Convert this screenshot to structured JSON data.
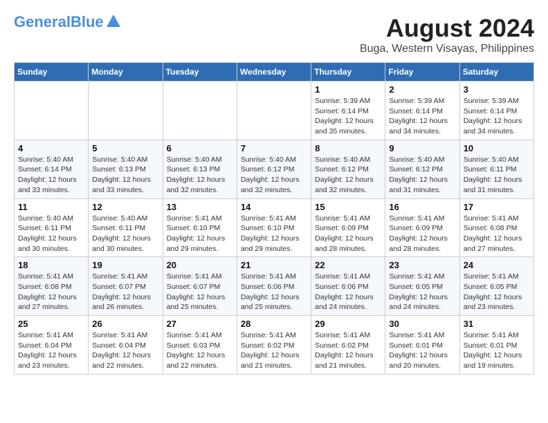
{
  "header": {
    "logo_line1": "General",
    "logo_line2": "Blue",
    "main_title": "August 2024",
    "subtitle": "Buga, Western Visayas, Philippines"
  },
  "calendar": {
    "days_of_week": [
      "Sunday",
      "Monday",
      "Tuesday",
      "Wednesday",
      "Thursday",
      "Friday",
      "Saturday"
    ],
    "weeks": [
      [
        {
          "day": "",
          "info": ""
        },
        {
          "day": "",
          "info": ""
        },
        {
          "day": "",
          "info": ""
        },
        {
          "day": "",
          "info": ""
        },
        {
          "day": "1",
          "info": "Sunrise: 5:39 AM\nSunset: 6:14 PM\nDaylight: 12 hours\nand 35 minutes."
        },
        {
          "day": "2",
          "info": "Sunrise: 5:39 AM\nSunset: 6:14 PM\nDaylight: 12 hours\nand 34 minutes."
        },
        {
          "day": "3",
          "info": "Sunrise: 5:39 AM\nSunset: 6:14 PM\nDaylight: 12 hours\nand 34 minutes."
        }
      ],
      [
        {
          "day": "4",
          "info": "Sunrise: 5:40 AM\nSunset: 6:14 PM\nDaylight: 12 hours\nand 33 minutes."
        },
        {
          "day": "5",
          "info": "Sunrise: 5:40 AM\nSunset: 6:13 PM\nDaylight: 12 hours\nand 33 minutes."
        },
        {
          "day": "6",
          "info": "Sunrise: 5:40 AM\nSunset: 6:13 PM\nDaylight: 12 hours\nand 32 minutes."
        },
        {
          "day": "7",
          "info": "Sunrise: 5:40 AM\nSunset: 6:12 PM\nDaylight: 12 hours\nand 32 minutes."
        },
        {
          "day": "8",
          "info": "Sunrise: 5:40 AM\nSunset: 6:12 PM\nDaylight: 12 hours\nand 32 minutes."
        },
        {
          "day": "9",
          "info": "Sunrise: 5:40 AM\nSunset: 6:12 PM\nDaylight: 12 hours\nand 31 minutes."
        },
        {
          "day": "10",
          "info": "Sunrise: 5:40 AM\nSunset: 6:11 PM\nDaylight: 12 hours\nand 31 minutes."
        }
      ],
      [
        {
          "day": "11",
          "info": "Sunrise: 5:40 AM\nSunset: 6:11 PM\nDaylight: 12 hours\nand 30 minutes."
        },
        {
          "day": "12",
          "info": "Sunrise: 5:40 AM\nSunset: 6:11 PM\nDaylight: 12 hours\nand 30 minutes."
        },
        {
          "day": "13",
          "info": "Sunrise: 5:41 AM\nSunset: 6:10 PM\nDaylight: 12 hours\nand 29 minutes."
        },
        {
          "day": "14",
          "info": "Sunrise: 5:41 AM\nSunset: 6:10 PM\nDaylight: 12 hours\nand 29 minutes."
        },
        {
          "day": "15",
          "info": "Sunrise: 5:41 AM\nSunset: 6:09 PM\nDaylight: 12 hours\nand 28 minutes."
        },
        {
          "day": "16",
          "info": "Sunrise: 5:41 AM\nSunset: 6:09 PM\nDaylight: 12 hours\nand 28 minutes."
        },
        {
          "day": "17",
          "info": "Sunrise: 5:41 AM\nSunset: 6:08 PM\nDaylight: 12 hours\nand 27 minutes."
        }
      ],
      [
        {
          "day": "18",
          "info": "Sunrise: 5:41 AM\nSunset: 6:08 PM\nDaylight: 12 hours\nand 27 minutes."
        },
        {
          "day": "19",
          "info": "Sunrise: 5:41 AM\nSunset: 6:07 PM\nDaylight: 12 hours\nand 26 minutes."
        },
        {
          "day": "20",
          "info": "Sunrise: 5:41 AM\nSunset: 6:07 PM\nDaylight: 12 hours\nand 25 minutes."
        },
        {
          "day": "21",
          "info": "Sunrise: 5:41 AM\nSunset: 6:06 PM\nDaylight: 12 hours\nand 25 minutes."
        },
        {
          "day": "22",
          "info": "Sunrise: 5:41 AM\nSunset: 6:06 PM\nDaylight: 12 hours\nand 24 minutes."
        },
        {
          "day": "23",
          "info": "Sunrise: 5:41 AM\nSunset: 6:05 PM\nDaylight: 12 hours\nand 24 minutes."
        },
        {
          "day": "24",
          "info": "Sunrise: 5:41 AM\nSunset: 6:05 PM\nDaylight: 12 hours\nand 23 minutes."
        }
      ],
      [
        {
          "day": "25",
          "info": "Sunrise: 5:41 AM\nSunset: 6:04 PM\nDaylight: 12 hours\nand 23 minutes."
        },
        {
          "day": "26",
          "info": "Sunrise: 5:41 AM\nSunset: 6:04 PM\nDaylight: 12 hours\nand 22 minutes."
        },
        {
          "day": "27",
          "info": "Sunrise: 5:41 AM\nSunset: 6:03 PM\nDaylight: 12 hours\nand 22 minutes."
        },
        {
          "day": "28",
          "info": "Sunrise: 5:41 AM\nSunset: 6:02 PM\nDaylight: 12 hours\nand 21 minutes."
        },
        {
          "day": "29",
          "info": "Sunrise: 5:41 AM\nSunset: 6:02 PM\nDaylight: 12 hours\nand 21 minutes."
        },
        {
          "day": "30",
          "info": "Sunrise: 5:41 AM\nSunset: 6:01 PM\nDaylight: 12 hours\nand 20 minutes."
        },
        {
          "day": "31",
          "info": "Sunrise: 5:41 AM\nSunset: 6:01 PM\nDaylight: 12 hours\nand 19 minutes."
        }
      ]
    ]
  }
}
